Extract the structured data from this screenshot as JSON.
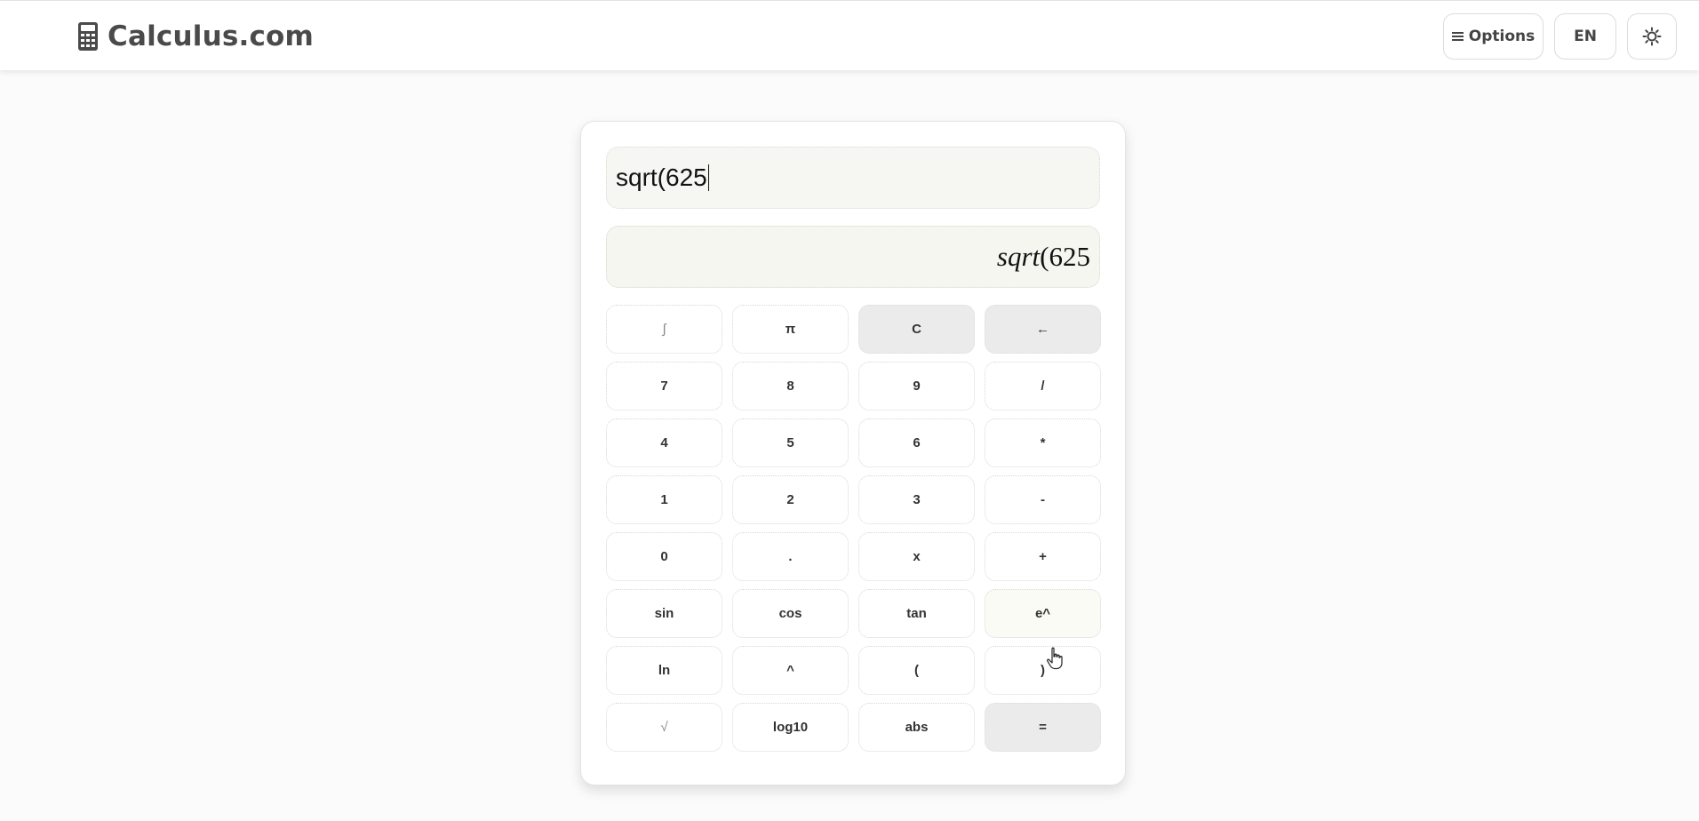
{
  "header": {
    "brand": "Calculus.com",
    "brand_icon": "calculator-icon",
    "options_label": "Options",
    "options_icon": "menu-icon",
    "language_label": "EN",
    "theme_icon": "sun-icon"
  },
  "calculator": {
    "input_value": "sqrt(625",
    "preview": {
      "func": "sqrt",
      "rest": "(625"
    },
    "keys": [
      "∫",
      "π",
      "C",
      "←",
      "7",
      "8",
      "9",
      "/",
      "4",
      "5",
      "6",
      "*",
      "1",
      "2",
      "3",
      "-",
      "0",
      ".",
      "x",
      "+",
      "sin",
      "cos",
      "tan",
      "e^",
      "ln",
      "^",
      "(",
      ")",
      "√",
      "log10",
      "abs",
      "="
    ]
  },
  "colors": {
    "brand_text": "#4a4a4a",
    "grey_key": "#ebebeb",
    "input_bg": "#f6f7f3"
  }
}
